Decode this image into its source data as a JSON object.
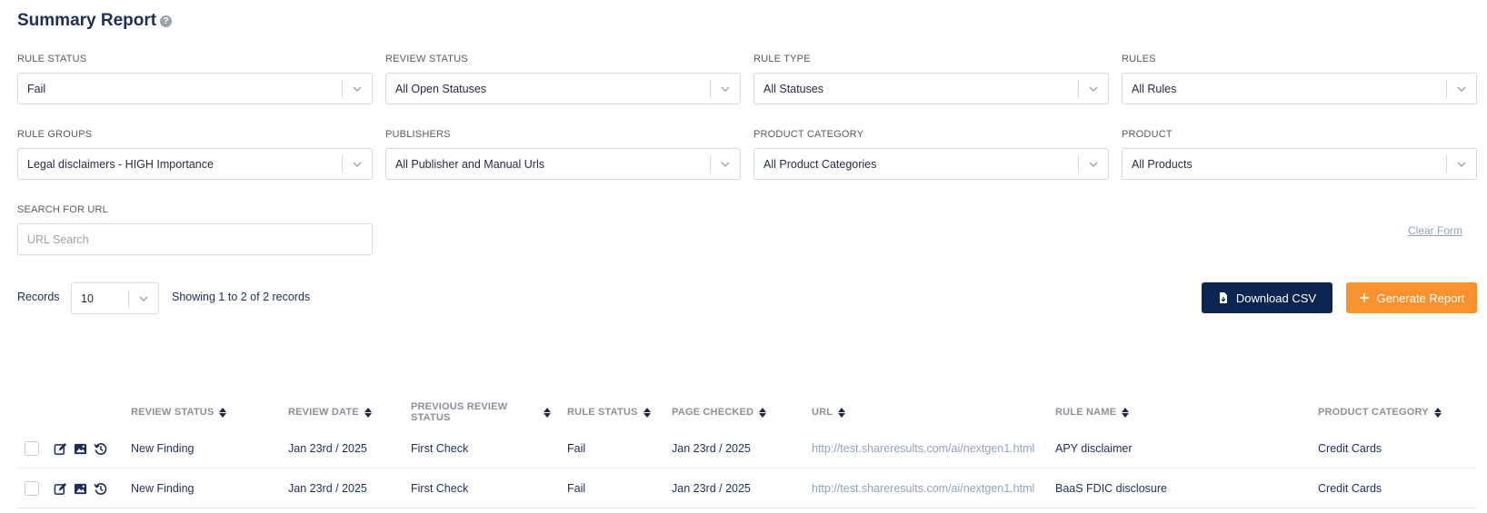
{
  "header": {
    "title": "Summary Report",
    "help_glyph": "?"
  },
  "filters": {
    "rule_status": {
      "label": "RULE STATUS",
      "value": "Fail"
    },
    "review_status": {
      "label": "REVIEW STATUS",
      "value": "All Open Statuses"
    },
    "rule_type": {
      "label": "RULE TYPE",
      "value": "All Statuses"
    },
    "rules": {
      "label": "RULES",
      "value": "All Rules"
    },
    "rule_groups": {
      "label": "RULE GROUPS",
      "value": "Legal disclaimers - HIGH Importance"
    },
    "publishers": {
      "label": "PUBLISHERS",
      "value": "All Publisher and Manual Urls"
    },
    "product_category": {
      "label": "PRODUCT CATEGORY",
      "value": "All Product Categories"
    },
    "product": {
      "label": "PRODUCT",
      "value": "All Products"
    },
    "search_url": {
      "label": "SEARCH FOR URL",
      "placeholder": "URL Search",
      "value": ""
    }
  },
  "clear_form": "Clear Form",
  "records": {
    "label": "Records",
    "value": "10",
    "showing": "Showing 1 to 2 of 2 records"
  },
  "buttons": {
    "download_csv": "Download CSV",
    "generate_report": "Generate Report"
  },
  "colors": {
    "navy": "#0c2550",
    "orange": "#f7922e",
    "link": "#8fa3bf"
  },
  "table": {
    "columns": [
      "REVIEW STATUS",
      "REVIEW DATE",
      "PREVIOUS REVIEW STATUS",
      "RULE STATUS",
      "PAGE CHECKED",
      "URL",
      "RULE NAME",
      "PRODUCT CATEGORY"
    ],
    "rows": [
      [
        "New Finding",
        "Jan 23rd / 2025",
        "First Check",
        "Fail",
        "Jan 23rd / 2025",
        "http://test.shareresults.com/ai/nextgen1.html",
        "APY disclaimer",
        "Credit Cards"
      ],
      [
        "New Finding",
        "Jan 23rd / 2025",
        "First Check",
        "Fail",
        "Jan 23rd / 2025",
        "http://test.shareresults.com/ai/nextgen1.html",
        "BaaS FDIC disclosure",
        "Credit Cards"
      ]
    ],
    "row_icons": [
      "edit-icon",
      "image-icon",
      "history-icon"
    ]
  }
}
